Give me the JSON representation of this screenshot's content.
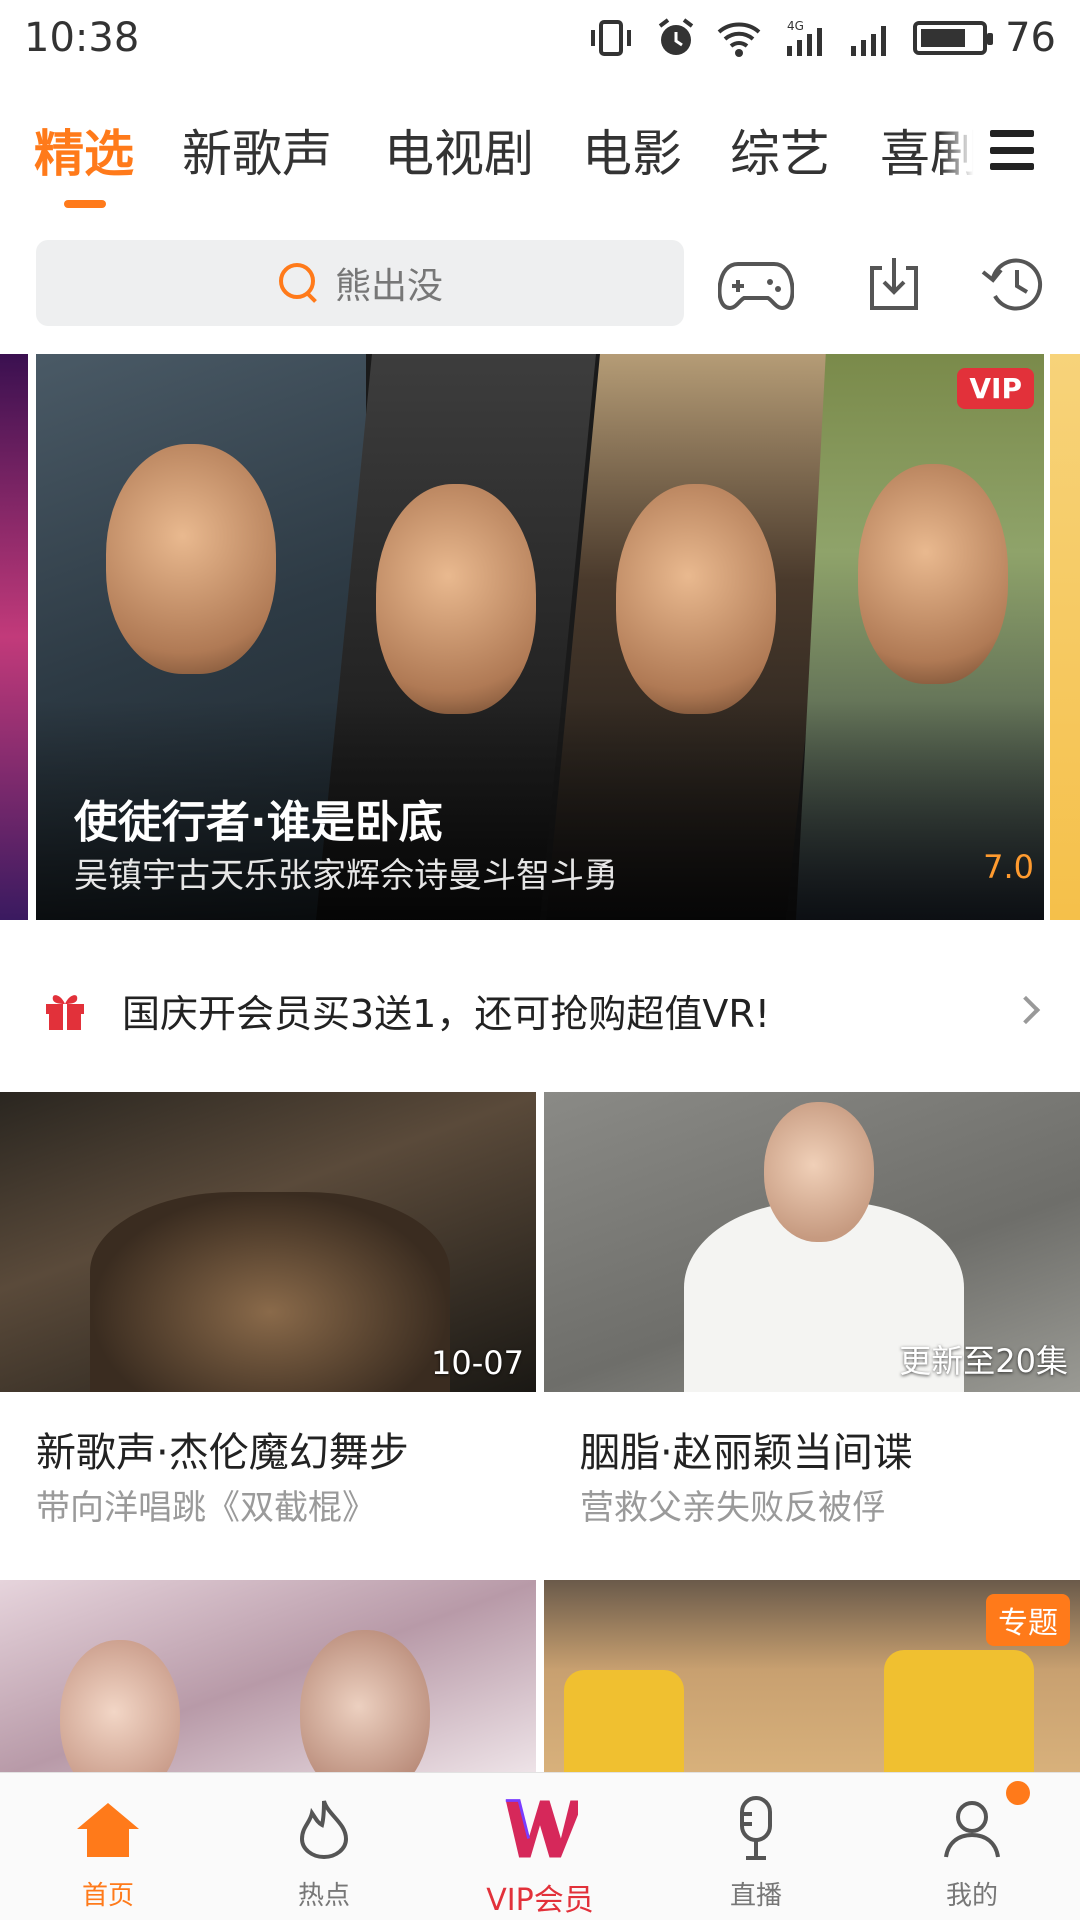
{
  "status_bar": {
    "time": "10:38",
    "battery": "76",
    "battery_level": 0.76
  },
  "tabs": [
    {
      "label": "精选",
      "active": true
    },
    {
      "label": "新歌声"
    },
    {
      "label": "电视剧"
    },
    {
      "label": "电影"
    },
    {
      "label": "综艺"
    },
    {
      "label": "喜剧"
    }
  ],
  "search": {
    "placeholder": "熊出没"
  },
  "toolbar_icons": [
    "game-controller-icon",
    "download-icon",
    "history-icon"
  ],
  "banner": {
    "title": "使徒行者·谁是卧底",
    "subtitle": "吴镇宇古天乐张家辉佘诗曼斗智斗勇",
    "score": "7.0",
    "badge": "VIP"
  },
  "promo": {
    "text": "国庆开会员买3送1，还可抢购超值VR!"
  },
  "cards": [
    {
      "title": "新歌声·杰伦魔幻舞步",
      "subtitle": "带向洋唱跳《双截棍》",
      "overlay": "10-07"
    },
    {
      "title": "胭脂·赵丽颖当间谍",
      "subtitle": "营救父亲失败反被俘",
      "overlay": "更新至20集"
    }
  ],
  "row2_cards": [
    {
      "badge": ""
    },
    {
      "badge": "专题"
    }
  ],
  "bottom_nav": [
    {
      "label": "首页",
      "active": true
    },
    {
      "label": "热点"
    },
    {
      "label": "VIP会员"
    },
    {
      "label": "直播"
    },
    {
      "label": "我的"
    }
  ],
  "colors": {
    "accent": "#ff7a1a",
    "vip_red": "#e2313a"
  }
}
